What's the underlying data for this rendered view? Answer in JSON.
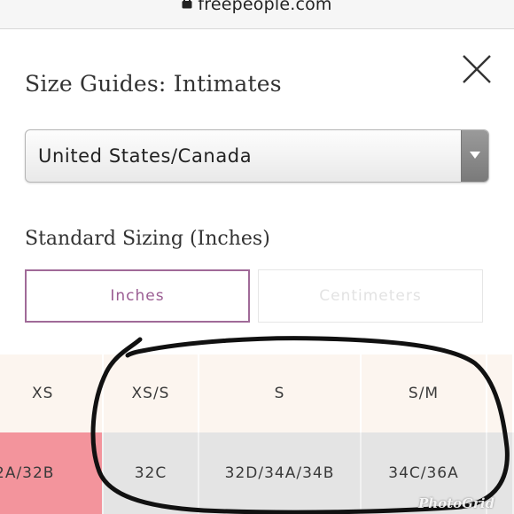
{
  "browser": {
    "url": "freepeople.com"
  },
  "modal": {
    "title": "Size Guides: Intimates",
    "region_select": {
      "value": "United States/Canada"
    },
    "section_title": "Standard Sizing (Inches)",
    "unit_tabs": [
      {
        "label": "Inches",
        "active": true
      },
      {
        "label": "Centimeters",
        "active": false
      }
    ]
  },
  "size_table": {
    "headers": [
      "XS",
      "XS/S",
      "S",
      "S/M"
    ],
    "values": [
      "2A/32B",
      "32C",
      "32D/34A/34B",
      "34C/36A"
    ]
  },
  "watermark": "PhotoGrid",
  "colors": {
    "accent": "#9a5c92",
    "header_bg": "#fcf5ef",
    "row_bg": "#e4e4e4",
    "highlight": "#f3949c",
    "annotation": "#111111"
  }
}
